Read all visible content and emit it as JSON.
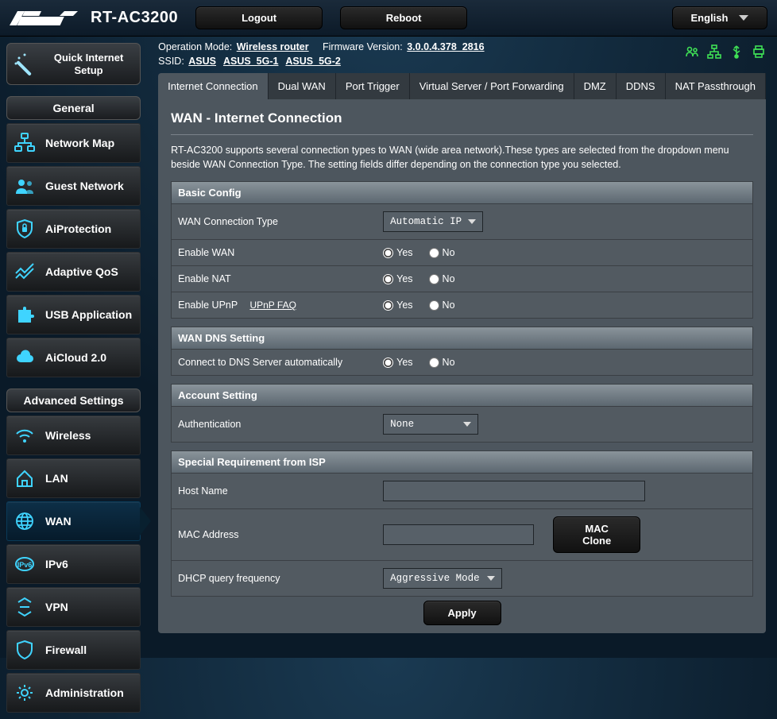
{
  "brand": "ASUS",
  "model": "RT-AC3200",
  "topbar": {
    "logout": "Logout",
    "reboot": "Reboot",
    "language": "English"
  },
  "qis": "Quick Internet Setup",
  "sections": {
    "general": "General",
    "advanced": "Advanced Settings"
  },
  "nav_general": [
    "Network Map",
    "Guest Network",
    "AiProtection",
    "Adaptive QoS",
    "USB Application",
    "AiCloud 2.0"
  ],
  "nav_advanced": [
    "Wireless",
    "LAN",
    "WAN",
    "IPv6",
    "VPN",
    "Firewall",
    "Administration"
  ],
  "meta": {
    "op_mode_label": "Operation Mode:",
    "op_mode_value": "Wireless router",
    "fw_label": "Firmware Version:",
    "fw_value": "3.0.0.4.378_2816",
    "ssid_label": "SSID:",
    "ssid": [
      "ASUS",
      "ASUS_5G-1",
      "ASUS_5G-2"
    ]
  },
  "tabs": [
    "Internet Connection",
    "Dual WAN",
    "Port Trigger",
    "Virtual Server / Port Forwarding",
    "DMZ",
    "DDNS",
    "NAT Passthrough"
  ],
  "panel": {
    "title": "WAN - Internet Connection",
    "desc": "RT-AC3200 supports several connection types to WAN (wide area network).These types are selected from the dropdown menu beside WAN Connection Type. The setting fields differ depending on the connection type you selected.",
    "basic_head": "Basic Config",
    "wct_label": "WAN Connection Type",
    "wct_value": "Automatic IP",
    "en_wan": "Enable WAN",
    "en_nat": "Enable NAT",
    "en_upnp": "Enable UPnP",
    "upnp_faq": "UPnP FAQ",
    "dns_head": "WAN DNS Setting",
    "dns_auto": "Connect to DNS Server automatically",
    "acct_head": "Account Setting",
    "auth_label": "Authentication",
    "auth_value": "None",
    "isp_head": "Special Requirement from ISP",
    "host_label": "Host Name",
    "host_value": "",
    "mac_label": "MAC Address",
    "mac_value": "",
    "mac_clone": "MAC Clone",
    "dhcp_label": "DHCP query frequency",
    "dhcp_value": "Aggressive Mode",
    "apply": "Apply",
    "yes": "Yes",
    "no": "No"
  }
}
